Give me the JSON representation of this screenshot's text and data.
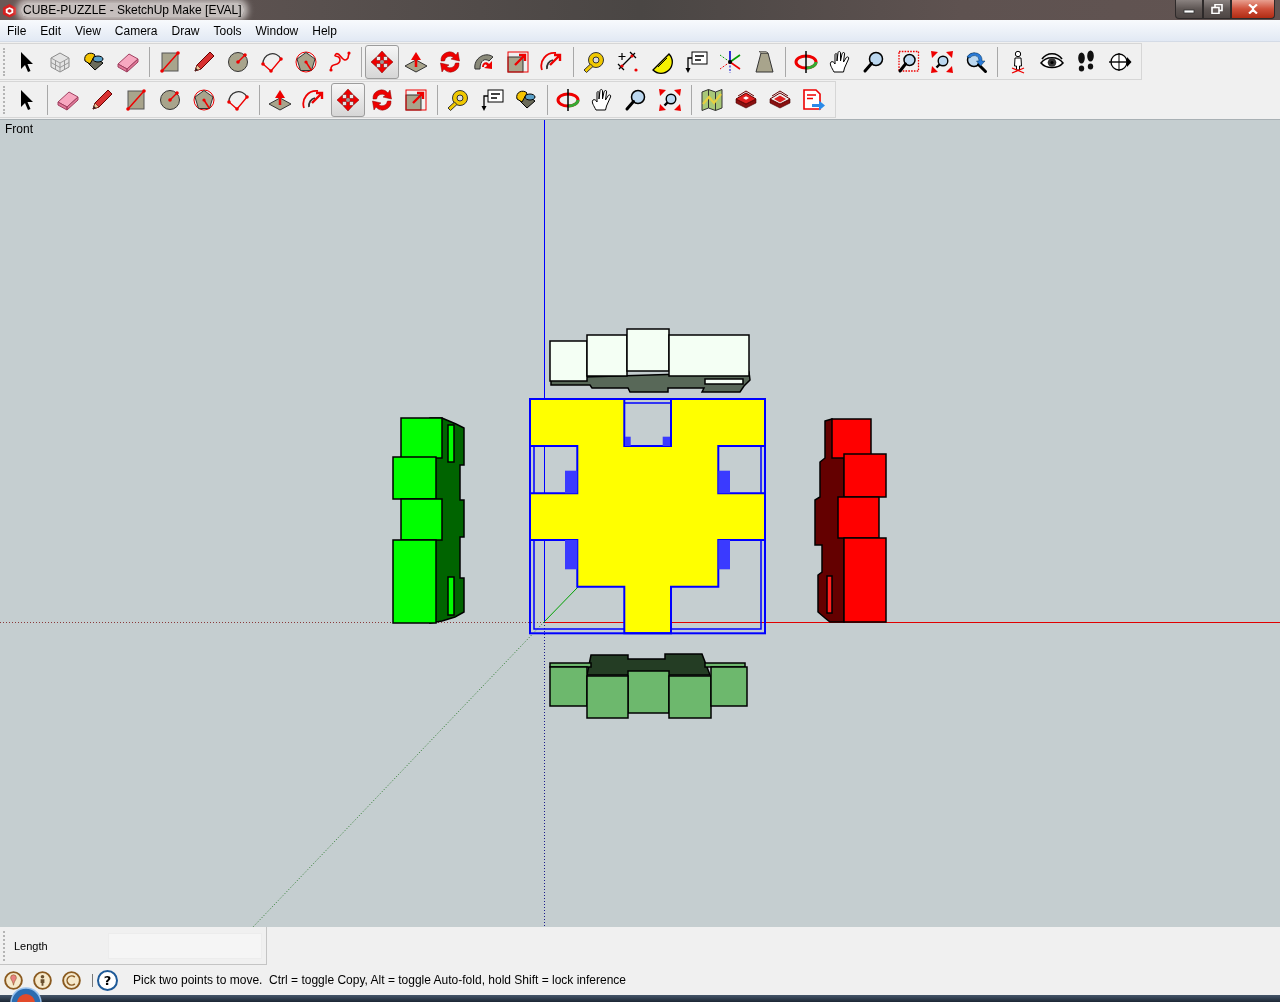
{
  "window": {
    "title": "CUBE-PUZZLE - SketchUp Make [EVAL]"
  },
  "menu": [
    "File",
    "Edit",
    "View",
    "Camera",
    "Draw",
    "Tools",
    "Window",
    "Help"
  ],
  "toolbars": [
    {
      "groups": [
        [
          {
            "kind": "select",
            "selected": false
          },
          {
            "kind": "component",
            "selected": false
          },
          {
            "kind": "paint",
            "selected": false
          },
          {
            "kind": "eraser",
            "selected": false
          }
        ],
        [
          {
            "kind": "rectangle",
            "selected": false
          },
          {
            "kind": "pencil",
            "selected": false
          },
          {
            "kind": "circle",
            "selected": false
          },
          {
            "kind": "arc",
            "selected": false
          },
          {
            "kind": "polygon",
            "selected": false
          },
          {
            "kind": "freehand",
            "selected": false
          }
        ],
        [
          {
            "kind": "move",
            "selected": true
          },
          {
            "kind": "pushpull",
            "selected": false
          },
          {
            "kind": "rotate",
            "selected": false
          },
          {
            "kind": "followme",
            "selected": false
          },
          {
            "kind": "scale",
            "selected": false
          },
          {
            "kind": "offset",
            "selected": false
          }
        ],
        [
          {
            "kind": "tape",
            "selected": false
          },
          {
            "kind": "dimension",
            "selected": false
          },
          {
            "kind": "protractor",
            "selected": false
          },
          {
            "kind": "text",
            "selected": false
          },
          {
            "kind": "axes",
            "selected": false
          },
          {
            "kind": "text3d",
            "selected": false
          }
        ],
        [
          {
            "kind": "orbit",
            "selected": false
          },
          {
            "kind": "pan",
            "selected": false
          },
          {
            "kind": "zoom",
            "selected": false
          },
          {
            "kind": "zoomwindow",
            "selected": false
          },
          {
            "kind": "zoomextents",
            "selected": false
          },
          {
            "kind": "previous",
            "selected": false
          }
        ],
        [
          {
            "kind": "position",
            "selected": false
          },
          {
            "kind": "lookaround",
            "selected": false
          },
          {
            "kind": "walk",
            "selected": false
          },
          {
            "kind": "section",
            "selected": false
          }
        ]
      ]
    },
    {
      "groups": [
        [
          {
            "kind": "select",
            "selected": false
          }
        ],
        [
          {
            "kind": "eraser",
            "selected": false
          },
          {
            "kind": "pencil",
            "selected": false
          },
          {
            "kind": "rectangle",
            "selected": false
          },
          {
            "kind": "circle",
            "selected": false
          },
          {
            "kind": "polygon",
            "selected": false
          },
          {
            "kind": "arc",
            "selected": false
          }
        ],
        [
          {
            "kind": "pushpull",
            "selected": false
          },
          {
            "kind": "offset",
            "selected": false
          },
          {
            "kind": "move",
            "selected": true
          },
          {
            "kind": "rotate",
            "selected": false
          },
          {
            "kind": "scale",
            "selected": false
          }
        ],
        [
          {
            "kind": "tape",
            "selected": false
          },
          {
            "kind": "text",
            "selected": false
          },
          {
            "kind": "paint",
            "selected": false
          }
        ],
        [
          {
            "kind": "orbit",
            "selected": false
          },
          {
            "kind": "pan",
            "selected": false
          },
          {
            "kind": "zoom",
            "selected": false
          },
          {
            "kind": "zoomextents",
            "selected": false
          }
        ],
        [
          {
            "kind": "map",
            "selected": false
          },
          {
            "kind": "warehouse",
            "selected": false
          },
          {
            "kind": "share",
            "selected": false
          },
          {
            "kind": "layout",
            "selected": false
          }
        ]
      ]
    }
  ],
  "viewport": {
    "view_label": "Front"
  },
  "measurements": {
    "label": "Length"
  },
  "status_bar": {
    "help": "?",
    "message": "Pick two points to move.  Ctrl = toggle Copy, Alt = toggle Auto-fold, hold Shift = lock inference"
  }
}
